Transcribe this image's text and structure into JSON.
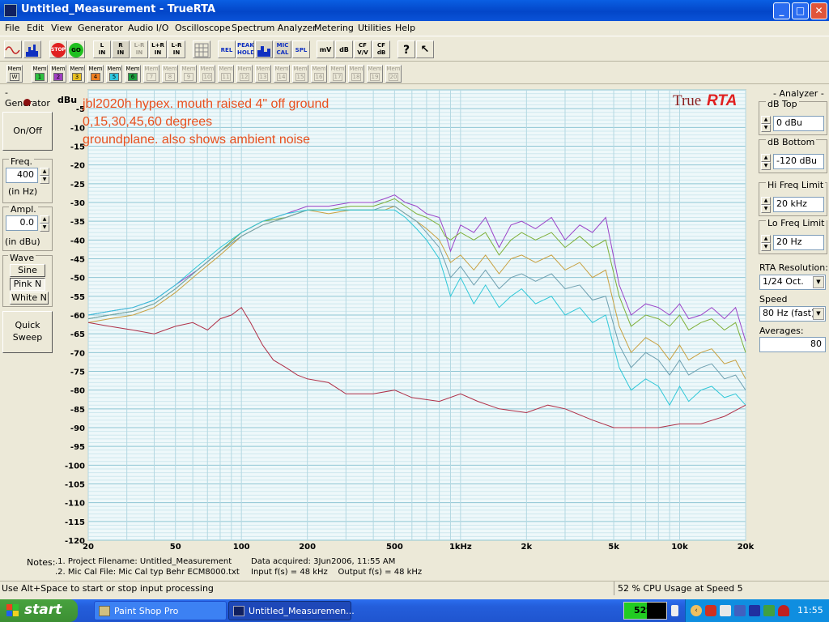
{
  "window": {
    "title": "Untitled_Measurement - TrueRTA"
  },
  "menu": [
    "File",
    "Edit",
    "View",
    "Generator",
    "Audio I/O",
    "Oscilloscope",
    "Spectrum Analyzer",
    "Metering",
    "Utilities",
    "Help"
  ],
  "toolbar": {
    "stop": "STOP",
    "go": "GO",
    "l_in": "L\nIN",
    "r_in": "R\nIN",
    "lr_in": "L-R\nIN",
    "lpr_in": "L+R\nIN",
    "lmr_in": "L-R\nIN",
    "rel": "REL",
    "peak_hold": "PEAK\nHOLD",
    "mic_cal": "MIC\nCAL",
    "spl": "SPL",
    "mv": "mV",
    "db": "dB",
    "cf_vv": "CF\nV/V",
    "cf_db": "CF\ndB",
    "help": "?"
  },
  "memories": {
    "mem_label": "Mem",
    "w": "W",
    "slots": [
      {
        "n": "1",
        "color": "#2fbf3f"
      },
      {
        "n": "2",
        "color": "#a040c0"
      },
      {
        "n": "3",
        "color": "#e8c020"
      },
      {
        "n": "4",
        "color": "#f08020"
      },
      {
        "n": "5",
        "color": "#30c8e0"
      },
      {
        "n": "6",
        "color": "#20a040"
      },
      {
        "n": "7",
        "color": ""
      },
      {
        "n": "8",
        "color": ""
      },
      {
        "n": "9",
        "color": ""
      },
      {
        "n": "10",
        "color": ""
      },
      {
        "n": "11",
        "color": ""
      },
      {
        "n": "12",
        "color": ""
      },
      {
        "n": "13",
        "color": ""
      },
      {
        "n": "14",
        "color": ""
      },
      {
        "n": "15",
        "color": ""
      },
      {
        "n": "16",
        "color": ""
      },
      {
        "n": "17",
        "color": ""
      },
      {
        "n": "18",
        "color": ""
      },
      {
        "n": "19",
        "color": ""
      },
      {
        "n": "20",
        "color": ""
      }
    ]
  },
  "generator": {
    "title": "- Generator -",
    "onoff": "On/Off",
    "freq_label": "Freq.",
    "freq": "400",
    "freq_unit": "(in Hz)",
    "ampl_label": "Ampl.",
    "ampl": "0.0",
    "ampl_unit": "(in dBu)",
    "wave_label": "Wave",
    "sine": "Sine",
    "pink": "Pink N",
    "white": "White N",
    "quick_sweep": "Quick\nSweep"
  },
  "analyzer": {
    "title": "- Analyzer -",
    "db_top_label": "dB Top",
    "db_top": "0 dBu",
    "db_bottom_label": "dB Bottom",
    "db_bottom": "-120 dBu",
    "hi_label": "Hi Freq Limit",
    "hi": "20 kHz",
    "lo_label": "Lo Freq Limit",
    "lo": "20 Hz",
    "res_label": "RTA Resolution:",
    "res": "1/24 Oct.",
    "speed_label": "Speed Tradeoff:",
    "speed": "80 Hz (fast)",
    "avg_label": "Averages:",
    "avg": "80"
  },
  "chart_data": {
    "type": "line",
    "annotations": [
      "jbl2020h hypex. mouth raised 4\" off ground",
      "0,15,30,45,60 degrees",
      "groundplane. also shows ambient noise"
    ],
    "logo": {
      "a": "True",
      "b": "RTA"
    },
    "ylabel": "dBu",
    "ylim": [
      -120,
      0
    ],
    "yticks": [
      "-5",
      "-10",
      "-15",
      "-20",
      "-25",
      "-30",
      "-35",
      "-40",
      "-45",
      "-50",
      "-55",
      "-60",
      "-65",
      "-70",
      "-75",
      "-80",
      "-85",
      "-90",
      "-95",
      "-100",
      "-105",
      "-110",
      "-115",
      "-120"
    ],
    "xscale": "log",
    "xlim": [
      20,
      20000
    ],
    "xticks": [
      {
        "v": 20,
        "t": "20"
      },
      {
        "v": 50,
        "t": "50"
      },
      {
        "v": 100,
        "t": "100"
      },
      {
        "v": 200,
        "t": "200"
      },
      {
        "v": 500,
        "t": "500"
      },
      {
        "v": 1000,
        "t": "1kHz"
      },
      {
        "v": 2000,
        "t": "2k"
      },
      {
        "v": 5000,
        "t": "5k"
      },
      {
        "v": 10000,
        "t": "10k"
      },
      {
        "v": 20000,
        "t": "20k"
      }
    ],
    "grid": true,
    "series": [
      {
        "color": "#9b44c8",
        "x": [
          20,
          25,
          32,
          40,
          50,
          63,
          80,
          100,
          125,
          160,
          200,
          250,
          315,
          400,
          450,
          500,
          560,
          630,
          700,
          800,
          850,
          900,
          1000,
          1150,
          1300,
          1500,
          1700,
          1900,
          2200,
          2600,
          3000,
          3500,
          4000,
          4600,
          5300,
          6000,
          7000,
          8000,
          9000,
          10000,
          11000,
          12500,
          14000,
          16000,
          18000,
          20000
        ],
        "y": [
          -60,
          -59,
          -58,
          -56,
          -52,
          -48,
          -43,
          -38,
          -35,
          -33,
          -31,
          -31,
          -30,
          -30,
          -29,
          -28,
          -30,
          -31,
          -33,
          -34,
          -38,
          -43,
          -36,
          -38,
          -34,
          -42,
          -36,
          -35,
          -37,
          -34,
          -40,
          -36,
          -38,
          -34,
          -52,
          -60,
          -57,
          -58,
          -60,
          -57,
          -61,
          -60,
          -58,
          -61,
          -58,
          -67
        ]
      },
      {
        "color": "#7fb03a",
        "x": [
          20,
          25,
          32,
          40,
          50,
          63,
          80,
          100,
          125,
          160,
          200,
          250,
          315,
          400,
          450,
          500,
          560,
          630,
          700,
          800,
          850,
          900,
          1000,
          1150,
          1300,
          1500,
          1700,
          1900,
          2200,
          2600,
          3000,
          3500,
          4000,
          4600,
          5300,
          6000,
          7000,
          8000,
          9000,
          10000,
          11000,
          12500,
          14000,
          16000,
          18000,
          20000
        ],
        "y": [
          -61,
          -60,
          -59,
          -57,
          -53,
          -48,
          -43,
          -38,
          -35,
          -34,
          -32,
          -32,
          -31,
          -31,
          -30,
          -29,
          -31,
          -33,
          -34,
          -36,
          -39,
          -40,
          -38,
          -40,
          -38,
          -44,
          -40,
          -38,
          -40,
          -38,
          -42,
          -39,
          -42,
          -40,
          -55,
          -63,
          -60,
          -61,
          -63,
          -60,
          -64,
          -62,
          -61,
          -64,
          -62,
          -70
        ]
      },
      {
        "color": "#c8a040",
        "x": [
          20,
          25,
          32,
          40,
          50,
          63,
          80,
          100,
          125,
          160,
          200,
          250,
          315,
          400,
          450,
          500,
          560,
          630,
          700,
          800,
          850,
          900,
          1000,
          1150,
          1300,
          1500,
          1700,
          1900,
          2200,
          2600,
          3000,
          3500,
          4000,
          4600,
          5300,
          6000,
          7000,
          8000,
          9000,
          10000,
          11000,
          12500,
          14000,
          16000,
          18000,
          20000
        ],
        "y": [
          -62,
          -61,
          -60,
          -58,
          -54,
          -49,
          -44,
          -39,
          -36,
          -34,
          -32,
          -33,
          -32,
          -32,
          -32,
          -31,
          -33,
          -35,
          -37,
          -40,
          -43,
          -46,
          -44,
          -48,
          -44,
          -49,
          -45,
          -44,
          -46,
          -44,
          -48,
          -46,
          -50,
          -48,
          -63,
          -70,
          -66,
          -68,
          -72,
          -68,
          -72,
          -70,
          -69,
          -73,
          -72,
          -77
        ]
      },
      {
        "color": "#6fa0b0",
        "x": [
          20,
          25,
          32,
          40,
          50,
          63,
          80,
          100,
          125,
          160,
          200,
          250,
          315,
          400,
          450,
          500,
          560,
          630,
          700,
          800,
          850,
          900,
          1000,
          1150,
          1300,
          1500,
          1700,
          1900,
          2200,
          2600,
          3000,
          3500,
          4000,
          4600,
          5300,
          6000,
          7000,
          8000,
          9000,
          10000,
          11000,
          12500,
          14000,
          16000,
          18000,
          20000
        ],
        "y": [
          -61,
          -60,
          -59,
          -57,
          -53,
          -48,
          -43,
          -39,
          -36,
          -34,
          -32,
          -32,
          -32,
          -32,
          -31,
          -31,
          -33,
          -35,
          -38,
          -42,
          -46,
          -50,
          -47,
          -52,
          -48,
          -53,
          -50,
          -49,
          -51,
          -49,
          -53,
          -52,
          -56,
          -55,
          -68,
          -74,
          -70,
          -72,
          -76,
          -72,
          -76,
          -74,
          -73,
          -77,
          -76,
          -80
        ]
      },
      {
        "color": "#30c8d8",
        "x": [
          20,
          25,
          32,
          40,
          50,
          63,
          80,
          100,
          125,
          160,
          200,
          250,
          315,
          400,
          450,
          500,
          560,
          630,
          700,
          800,
          850,
          900,
          1000,
          1150,
          1300,
          1500,
          1700,
          1900,
          2200,
          2600,
          3000,
          3500,
          4000,
          4600,
          5300,
          6000,
          7000,
          8000,
          9000,
          10000,
          11000,
          12500,
          14000,
          16000,
          18000,
          20000
        ],
        "y": [
          -60,
          -59,
          -58,
          -56,
          -52,
          -47,
          -42,
          -38,
          -35,
          -33,
          -32,
          -32,
          -32,
          -32,
          -32,
          -32,
          -34,
          -37,
          -40,
          -45,
          -50,
          -55,
          -50,
          -57,
          -52,
          -58,
          -55,
          -53,
          -57,
          -55,
          -60,
          -58,
          -62,
          -60,
          -74,
          -80,
          -77,
          -79,
          -84,
          -79,
          -83,
          -80,
          -79,
          -82,
          -81,
          -84
        ]
      },
      {
        "color": "#b03048",
        "x": [
          20,
          25,
          32,
          40,
          50,
          60,
          70,
          80,
          90,
          100,
          110,
          125,
          140,
          160,
          180,
          200,
          250,
          300,
          400,
          500,
          600,
          800,
          1000,
          1200,
          1500,
          2000,
          2500,
          3000,
          4000,
          5000,
          6000,
          8000,
          10000,
          12500,
          16000,
          20000
        ],
        "y": [
          -62,
          -63,
          -64,
          -65,
          -63,
          -62,
          -64,
          -61,
          -60,
          -58,
          -62,
          -68,
          -72,
          -74,
          -76,
          -77,
          -78,
          -81,
          -81,
          -80,
          -82,
          -83,
          -81,
          -83,
          -85,
          -86,
          -84,
          -85,
          -88,
          -90,
          -90,
          -90,
          -89,
          -89,
          -87,
          -84
        ]
      }
    ]
  },
  "notes": {
    "label": "Notes:",
    "line1": ".1. Project Filename: Untitled_Measurement",
    "line2": ".2. Mic Cal File: Mic Cal typ Behr ECM8000.txt",
    "acquired": "Data acquired: 3Jun2006, 11:55 AM",
    "rates": "Input f(s) = 48 kHz    Output f(s) = 48 kHz"
  },
  "status": {
    "hint": "Use Alt+Space to start or stop input processing",
    "cpu": "52 % CPU Usage at Speed 5"
  },
  "taskbar": {
    "start": "start",
    "task1": "Paint Shop Pro",
    "task2": "Untitled_Measuremen...",
    "cpu_meter": "52%",
    "clock": "11:55"
  }
}
